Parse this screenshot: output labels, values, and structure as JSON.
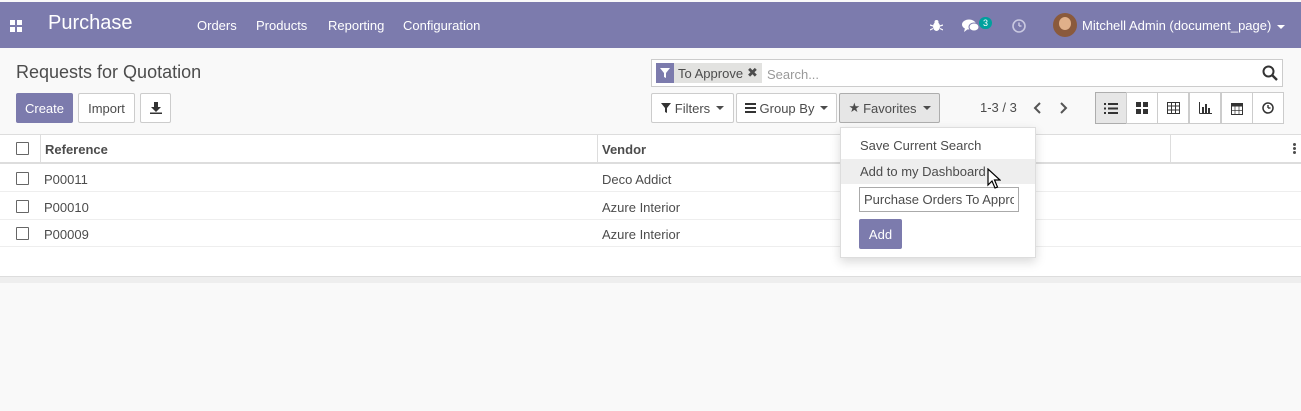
{
  "navbar": {
    "app_name": "Purchase",
    "menu": [
      "Orders",
      "Products",
      "Reporting",
      "Configuration"
    ],
    "messages_count": "3",
    "user": "Mitchell Admin (document_page)",
    "accent_color": "#7c7bad"
  },
  "control_panel": {
    "title": "Requests for Quotation",
    "search": {
      "facet": "To Approve",
      "placeholder": "Search..."
    },
    "buttons": {
      "create": "Create",
      "import": "Import"
    },
    "filters_label": "Filters",
    "group_by_label": "Group By",
    "favorites_label": "Favorites",
    "pager": "1-3 / 3",
    "views": [
      "list-icon",
      "kanban-icon",
      "pivot-icon",
      "graph-icon",
      "calendar-icon",
      "activity-icon"
    ]
  },
  "table": {
    "columns": [
      "Reference",
      "Vendor"
    ],
    "rows": [
      {
        "reference": "P00011",
        "vendor": "Deco Addict"
      },
      {
        "reference": "P00010",
        "vendor": "Azure Interior"
      },
      {
        "reference": "P00009",
        "vendor": "Azure Interior"
      }
    ]
  },
  "favorites_menu": {
    "items": [
      "Save Current Search",
      "Add to my Dashboard"
    ],
    "dashboard_input_value": "Purchase Orders To Approve",
    "add_label": "Add"
  }
}
